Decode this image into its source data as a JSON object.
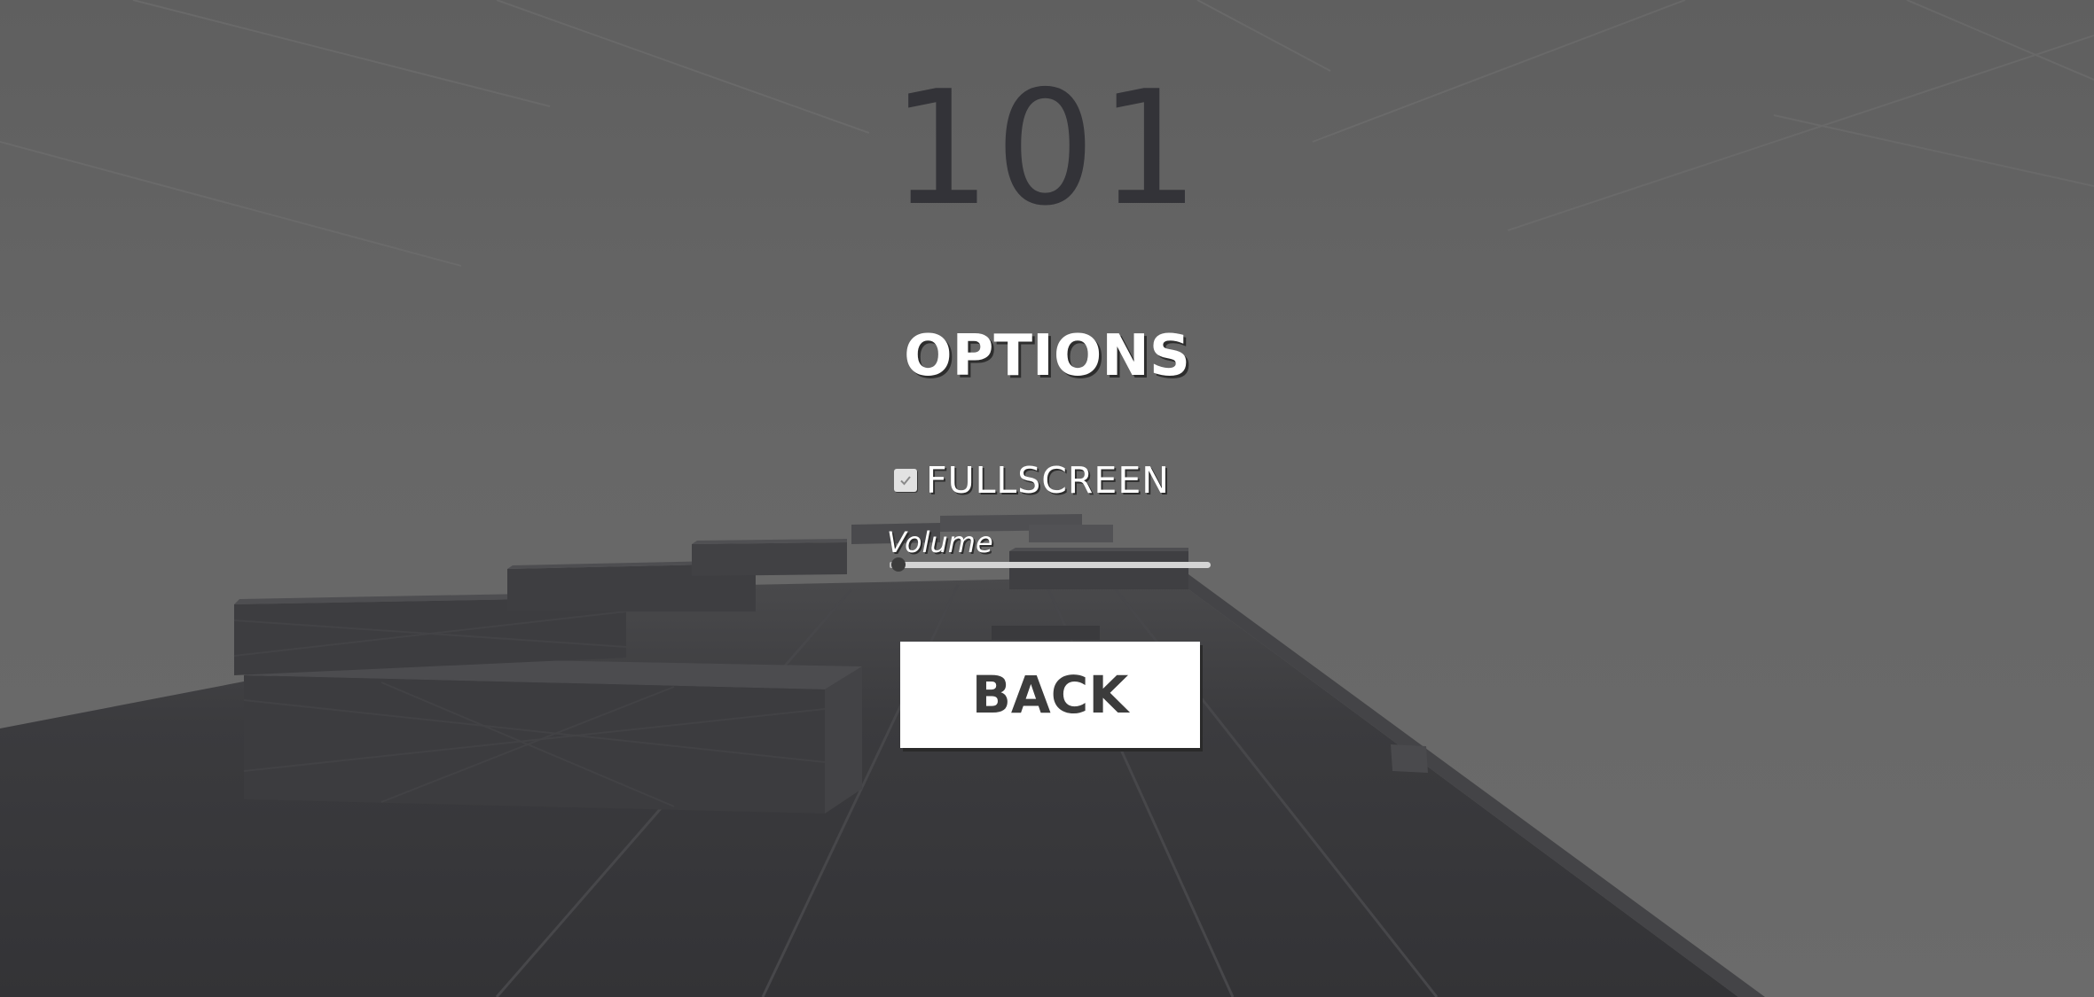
{
  "hud": {
    "score": "101"
  },
  "options_menu": {
    "title": "OPTIONS",
    "fullscreen": {
      "label": "FULLSCREEN",
      "checked": true
    },
    "volume": {
      "label": "Volume",
      "value": 0.01
    },
    "back_label": "BACK"
  },
  "colors": {
    "sky": "#666666",
    "floor": "#37373a",
    "score_text": "#333338",
    "button_bg": "#ffffff",
    "button_text": "#3c3c3c"
  }
}
